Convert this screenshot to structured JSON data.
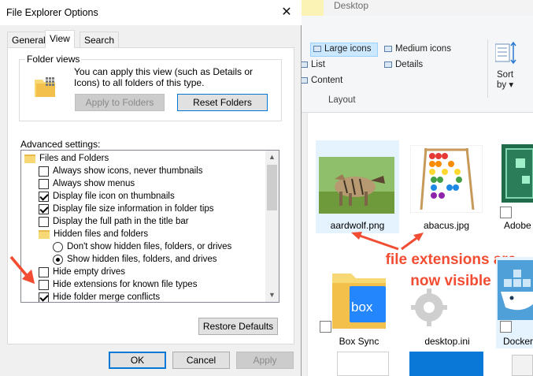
{
  "dialog": {
    "title": "File Explorer Options",
    "close_glyph": "✕",
    "tabs": [
      {
        "label": "General",
        "active": false
      },
      {
        "label": "View",
        "active": true
      },
      {
        "label": "Search",
        "active": false
      }
    ],
    "folder_views": {
      "title": "Folder views",
      "description": "You can apply this view (such as Details or Icons) to all folders of this type.",
      "apply_button": "Apply to Folders",
      "reset_button": "Reset Folders"
    },
    "advanced": {
      "label": "Advanced settings:",
      "items": [
        {
          "type": "folder",
          "label": "Files and Folders",
          "indent": 0
        },
        {
          "type": "checkbox",
          "label": "Always show icons, never thumbnails",
          "checked": false,
          "indent": 1
        },
        {
          "type": "checkbox",
          "label": "Always show menus",
          "checked": false,
          "indent": 1
        },
        {
          "type": "checkbox",
          "label": "Display file icon on thumbnails",
          "checked": true,
          "indent": 1
        },
        {
          "type": "checkbox",
          "label": "Display file size information in folder tips",
          "checked": true,
          "indent": 1
        },
        {
          "type": "checkbox",
          "label": "Display the full path in the title bar",
          "checked": false,
          "indent": 1
        },
        {
          "type": "folder",
          "label": "Hidden files and folders",
          "indent": 1
        },
        {
          "type": "radio",
          "label": "Don't show hidden files, folders, or drives",
          "checked": false,
          "indent": 2
        },
        {
          "type": "radio",
          "label": "Show hidden files, folders, and drives",
          "checked": true,
          "indent": 2
        },
        {
          "type": "checkbox",
          "label": "Hide empty drives",
          "checked": false,
          "indent": 1
        },
        {
          "type": "checkbox",
          "label": "Hide extensions for known file types",
          "checked": false,
          "indent": 1
        },
        {
          "type": "checkbox",
          "label": "Hide folder merge conflicts",
          "checked": true,
          "indent": 1
        }
      ],
      "restore_button": "Restore Defaults"
    },
    "footer": {
      "ok": "OK",
      "cancel": "Cancel",
      "apply": "Apply"
    }
  },
  "explorer": {
    "ribbon_tab": "Desktop",
    "layout_options": [
      {
        "label": "Large icons",
        "selected": true
      },
      {
        "label": "Medium icons",
        "selected": false
      },
      {
        "label": "List",
        "selected": false
      },
      {
        "label": "Details",
        "selected": false
      },
      {
        "label": "Content",
        "selected": false
      }
    ],
    "layout_group_label": "Layout",
    "sort_label_1": "Sort",
    "sort_label_2": "by ▾",
    "files": [
      {
        "name": "aardwolf.png",
        "selected": true
      },
      {
        "name": "abacus.jpg",
        "selected": false
      },
      {
        "name": "Adobe",
        "selected": false
      },
      {
        "name": "Box Sync",
        "selected": false
      },
      {
        "name": "desktop.ini",
        "selected": false
      },
      {
        "name": "Docker",
        "selected": true
      }
    ]
  },
  "annotation": {
    "text": "file extensions are now visible",
    "color": "#f24d33"
  },
  "colors": {
    "accent": "#0078d7",
    "selection": "#cce8ff",
    "annotation": "#f24d33"
  }
}
